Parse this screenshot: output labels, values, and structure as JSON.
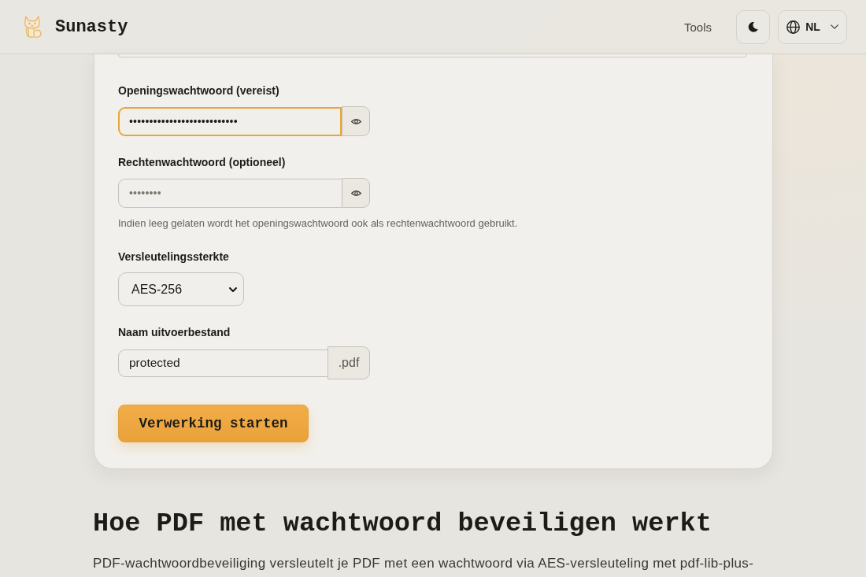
{
  "header": {
    "brand": "Sunasty",
    "nav": [
      "Tools"
    ],
    "language": "NL"
  },
  "form": {
    "fields": [
      {
        "kind": "partial"
      },
      {
        "kind": "password",
        "label": "Openingswachtwoord (vereist)",
        "value": "•••••••••••••••••••••••••••",
        "focused": true
      },
      {
        "kind": "password",
        "label": "Rechtenwachtwoord (optioneel)",
        "placeholder": "••••••••",
        "focused": false,
        "hint": "Indien leeg gelaten wordt het openingswachtwoord ook als rechtenwachtwoord gebruikt."
      },
      {
        "kind": "select",
        "label": "Versleutelingssterkte",
        "value": "AES-256"
      },
      {
        "kind": "addon",
        "label": "Naam uitvoerbestand",
        "value": "protected",
        "suffix": ".pdf"
      }
    ],
    "submit": "Verwerking starten"
  },
  "section": {
    "heading": "Hoe PDF met wachtwoord beveiligen werkt",
    "paragraph": "PDF-wachtwoordbeveiliging versleutelt je PDF met een wachtwoord via AES-versleuteling met pdf-lib-plus-"
  }
}
